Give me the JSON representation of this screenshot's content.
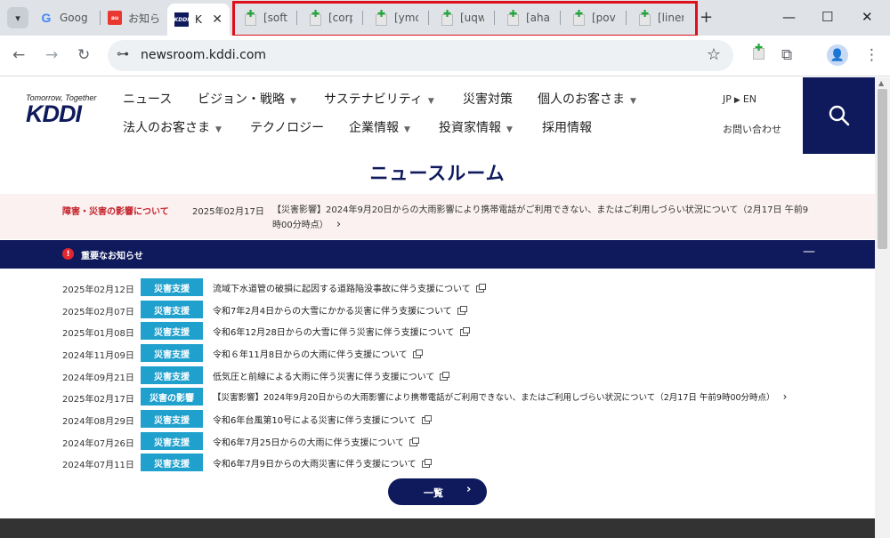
{
  "tabs": [
    {
      "title": "Goog",
      "favicon": "google-icon"
    },
    {
      "title": "お知ら",
      "favicon": "au-icon"
    },
    {
      "title": "K",
      "favicon": "kddi-icon"
    }
  ],
  "tab_group": [
    {
      "title": "[softb"
    },
    {
      "title": "[corp"
    },
    {
      "title": "[ymo"
    },
    {
      "title": "[uqw"
    },
    {
      "title": "[ahar"
    },
    {
      "title": "[povc"
    },
    {
      "title": "[liner"
    }
  ],
  "tabstrip_icons": {
    "tab_search": "▾",
    "close": "✕",
    "new_tab": "+",
    "minimize": "—",
    "maximize": "☐",
    "close_window": "✕"
  },
  "toolbar": {
    "url": "newsroom.kddi.com",
    "icons": {
      "back": "←",
      "forward": "→",
      "reload": "↻",
      "tune": "⊶",
      "star": "☆",
      "extensions": "⧉",
      "menu": "⋮",
      "profile": "👤"
    }
  },
  "site": {
    "tagline": "Tomorrow, Together",
    "brand": "KDDI",
    "nav": [
      {
        "label": "ニュース"
      },
      {
        "label": "ビジョン・戦略",
        "caret": "▼"
      },
      {
        "label": "サステナビリティ",
        "caret": "▼"
      },
      {
        "label": "災害対策"
      },
      {
        "label": "個人のお客さま",
        "caret": "▼"
      },
      {
        "label": "法人のお客さま",
        "caret": "▼"
      },
      {
        "label": "テクノロジー"
      },
      {
        "label": "企業情報",
        "caret": "▼"
      },
      {
        "label": "投資家情報",
        "caret": "▼"
      },
      {
        "label": "採用情報"
      }
    ],
    "lang_jp": "JP",
    "lang_arrow": "▶",
    "lang_en": "EN",
    "contact": "お問い合わせ",
    "search_icon": "⚲"
  },
  "page_title": "ニュースルーム",
  "disaster_banner": {
    "label": "障害・災害の影響について",
    "date": "2025年02月17日",
    "text": "【災害影響】2024年9月20日からの大雨影響により携帯電話がご利用できない、またはご利用しづらい状況について（2月17日 午前9時00分時点）",
    "arrow": "›"
  },
  "notice": {
    "icon": "!",
    "title": "重要なお知らせ",
    "collapse": "—"
  },
  "news": [
    {
      "date": "2025年02月12日",
      "tag": "災害支援",
      "title": "流域下水道管の破損に起因する道路陥没事故に伴う支援について",
      "end": "ext"
    },
    {
      "date": "2025年02月07日",
      "tag": "災害支援",
      "title": "令和7年2月4日からの大雪にかかる災害に伴う支援について",
      "end": "ext"
    },
    {
      "date": "2025年01月08日",
      "tag": "災害支援",
      "title": "令和6年12月28日からの大雪に伴う災害に伴う支援について",
      "end": "ext"
    },
    {
      "date": "2024年11月09日",
      "tag": "災害支援",
      "title": "令和６年11月8日からの大雨に伴う支援について",
      "end": "ext"
    },
    {
      "date": "2024年09月21日",
      "tag": "災害支援",
      "title": "低気圧と前線による大雨に伴う災害に伴う支援について",
      "end": "ext"
    },
    {
      "date": "2025年02月17日",
      "tag": "災害の影響",
      "title": "【災害影響】2024年9月20日からの大雨影響により携帯電話がご利用できない、またはご利用しづらい状況について（2月17日 午前9時00分時点）",
      "end": "›"
    },
    {
      "date": "2024年08月29日",
      "tag": "災害支援",
      "title": "令和6年台風第10号による災害に伴う支援について",
      "end": "ext"
    },
    {
      "date": "2024年07月26日",
      "tag": "災害支援",
      "title": "令和6年7月25日からの大雨に伴う支援について",
      "end": "ext"
    },
    {
      "date": "2024年07月11日",
      "tag": "災害支援",
      "title": "令和6年7月9日からの大雨災害に伴う支援について",
      "end": "ext"
    }
  ],
  "list_button": {
    "label": "一覧",
    "arrow": "›"
  },
  "colors": {
    "brand_navy": "#0f1a5c",
    "badge_blue": "#1fa0cd",
    "alert_red": "#c4262e",
    "group_outline": "#e0101a"
  }
}
